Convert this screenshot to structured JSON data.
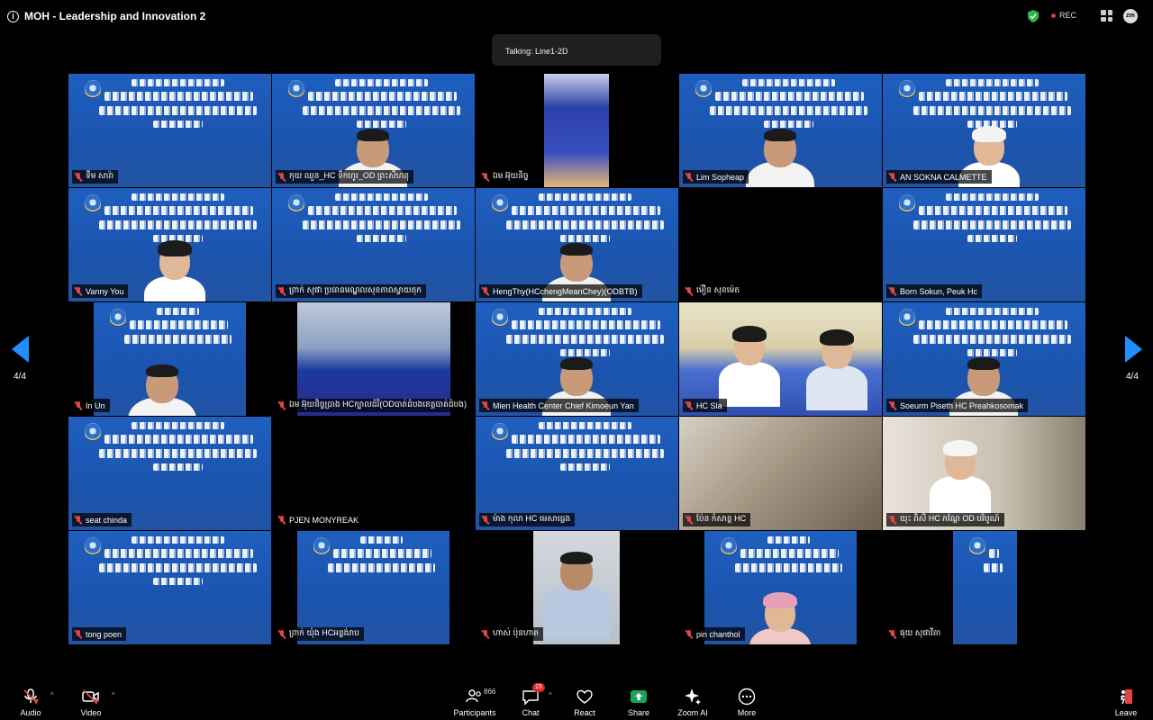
{
  "window": {
    "title": "MOH - Leadership and Innovation 2",
    "rec_label": "REC",
    "avatar_label": "zm"
  },
  "talking": "Talking: Line1-2D",
  "pagination": {
    "left": "4/4",
    "right": "4/4"
  },
  "participants": [
    {
      "name": "ទីម សារ៉ា",
      "kind": "slide"
    },
    {
      "name": "កុយ ឈួន_HC ទឹកហូរ_OD ព្រះសីហនុ",
      "kind": "slide-person"
    },
    {
      "name": "ឯម អ៊ុយនិច្ច",
      "kind": "room-narrow"
    },
    {
      "name": "Lim Sopheap",
      "kind": "slide-person"
    },
    {
      "name": "AN SOKNA CALMETTE",
      "kind": "slide-woman"
    },
    {
      "name": "Vanny You",
      "kind": "slide-woman"
    },
    {
      "name": "ព្រាក់ សុផា ប្រធានមណ្ឌលសុខភាពស្វាយតុក",
      "kind": "slide"
    },
    {
      "name": "HengThy(HCchengMeanChey)(ODBTB)",
      "kind": "slide-person"
    },
    {
      "name": "ម៉ឿន សុខម៉េត",
      "kind": "black"
    },
    {
      "name": "Born Sokun, Peuk Hc",
      "kind": "slide"
    },
    {
      "name": "In Un",
      "kind": "slide-person-narrow"
    },
    {
      "name": "ឯម អ៊ុយនិច្ចប្រាង HCក្បាលដំរី(ODបាត់ដំបងខេត្តបាត់ដំបង)",
      "kind": "room-fan"
    },
    {
      "name": "Mien Health Center Chief Kimoeun Yan",
      "kind": "slide-person"
    },
    {
      "name": "HC Sla",
      "kind": "room-clinic"
    },
    {
      "name": "Soeurm Piseth HC Preahkosomak",
      "kind": "slide-person"
    },
    {
      "name": "seat chinda",
      "kind": "slide"
    },
    {
      "name": "PJEN MONYREAK",
      "kind": "slide-bright"
    },
    {
      "name": "ម៉ាង កុលា HC មេសាធ្លេង",
      "kind": "slide"
    },
    {
      "name": "ប៉ែន កំសាន្ត HC",
      "kind": "room-blur"
    },
    {
      "name": "យុះ ពិសី HC កណ្ដែ OD បរិបូណ៍",
      "kind": "room-man-cap"
    },
    {
      "name": "tong poen",
      "kind": "slide"
    },
    {
      "name": "ព្រាក់ យ៉ុង HCអន្លង់រាប",
      "kind": "slide-narrow"
    },
    {
      "name": "ហាស់ ប៉ុនហាត",
      "kind": "room-man"
    },
    {
      "name": "pin chanthol",
      "kind": "slide-woman-narrow"
    },
    {
      "name": "ផុយ សុផាវីតា",
      "kind": "slide-thin"
    }
  ],
  "toolbar": {
    "audio": "Audio",
    "video": "Video",
    "participants": "Participants",
    "participants_count": "866",
    "chat": "Chat",
    "chat_badge": "15",
    "react": "React",
    "share": "Share",
    "zoom_ai": "Zoom AI",
    "more": "More",
    "leave": "Leave"
  },
  "colors": {
    "slide_blue": "#1f5fbf",
    "share_green": "#19a35b",
    "nav_blue": "#1f8fff",
    "muted_red": "#e04545"
  }
}
